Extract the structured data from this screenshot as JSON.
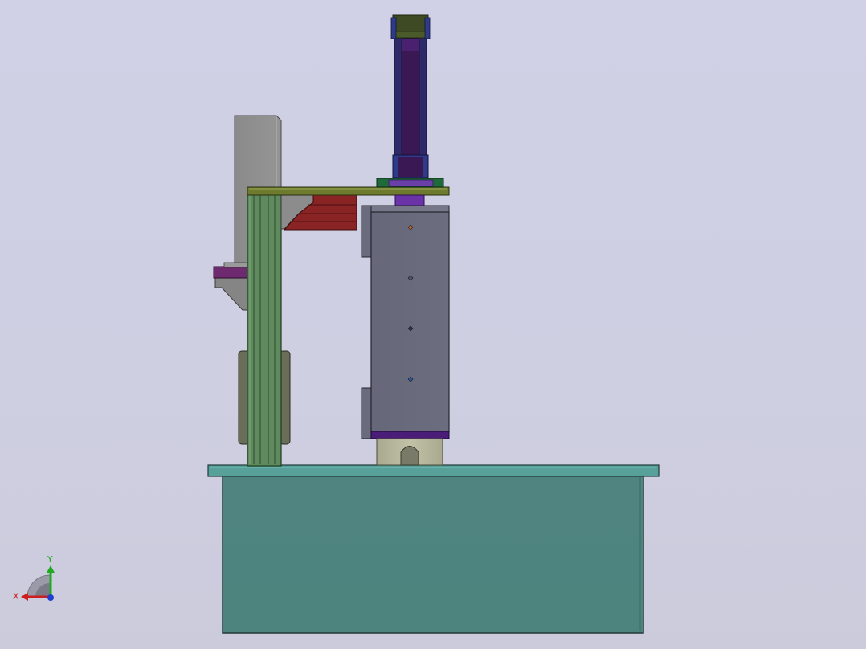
{
  "view": {
    "background_top": "#d0d0e6",
    "background_bottom": "#cbcbdc"
  },
  "model": {
    "parts": [
      {
        "name": "base-table",
        "color": "#52857f"
      },
      {
        "name": "table-top-plate",
        "color": "#57a09a"
      },
      {
        "name": "vertical-column-profile",
        "color": "#5e8a5e"
      },
      {
        "name": "column-gusset-bracket",
        "color": "#8a8a8a"
      },
      {
        "name": "rear-mount-plate",
        "color": "#8e8e8e"
      },
      {
        "name": "purple-clamp-block",
        "color": "#6e2a6e"
      },
      {
        "name": "top-crossbeam-plate",
        "color": "#6e7a2e"
      },
      {
        "name": "red-bracket",
        "color": "#8a2424"
      },
      {
        "name": "pneumatic-cylinder",
        "color": "#3a1854"
      },
      {
        "name": "cylinder-end-caps",
        "color": "#3d4a24"
      },
      {
        "name": "cylinder-flange",
        "color": "#1f6a3a"
      },
      {
        "name": "press-housing-box",
        "color": "#6a6c7d"
      },
      {
        "name": "press-base-ring",
        "color": "#4a1e78"
      },
      {
        "name": "bottom-die-block",
        "color": "#b4b49a"
      },
      {
        "name": "side-handle-block",
        "color": "#6a6e58"
      }
    ],
    "housing_markers": [
      {
        "color": "#c46a1a"
      },
      {
        "color": "#555566"
      },
      {
        "color": "#333344"
      },
      {
        "color": "#2a5aa0"
      }
    ]
  },
  "triad": {
    "x_label": "X",
    "y_label": "Y",
    "x_color": "#cc1f1f",
    "y_color": "#1faa1f",
    "z_color": "#1f3fcc"
  }
}
